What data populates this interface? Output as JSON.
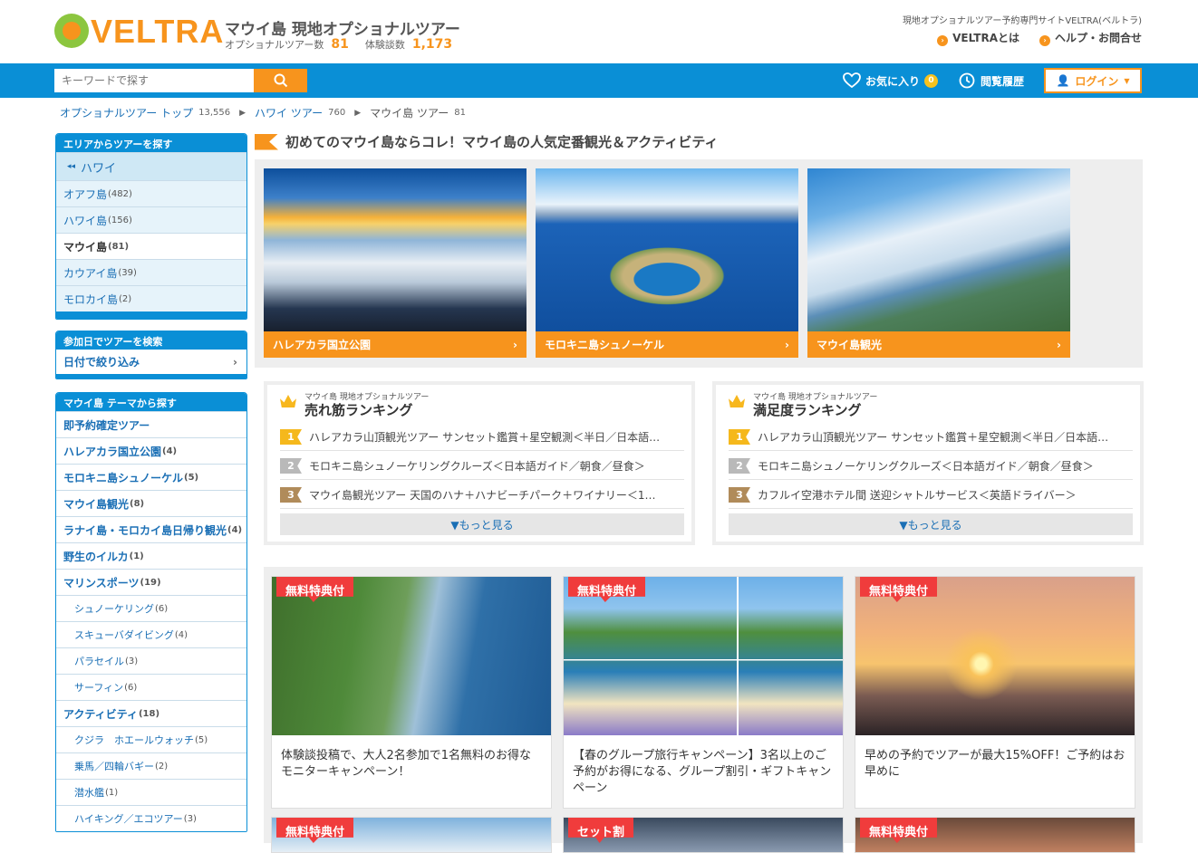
{
  "header": {
    "logo_text": "VELTRA",
    "site_title": "マウイ島 現地オプショナルツアー",
    "tour_count_label": "オプショナルツアー数",
    "tour_count": "81",
    "review_count_label": "体験談数",
    "review_count": "1,173",
    "tagline": "現地オプショナルツアー予約専門サイトVELTRA(ベルトラ)",
    "links": [
      "VELTRAとは",
      "ヘルプ・お問合せ"
    ]
  },
  "navbar": {
    "search_placeholder": "キーワードで探す",
    "favorites_label": "お気に入り",
    "favorites_count": "0",
    "history_label": "閲覧履歴",
    "login_label": "ログイン"
  },
  "breadcrumb": [
    {
      "label": "オプショナルツアー トップ",
      "count": "13,556"
    },
    {
      "label": "ハワイ ツアー",
      "count": "760"
    },
    {
      "label": "マウイ島 ツアー",
      "count": "81"
    }
  ],
  "sidebar": {
    "area_heading": "エリアからツアーを探す",
    "area_parent": "ハワイ",
    "areas": [
      {
        "label": "オアフ島",
        "count": "(482)"
      },
      {
        "label": "ハワイ島",
        "count": "(156)"
      },
      {
        "label": "マウイ島",
        "count": "(81)"
      },
      {
        "label": "カウアイ島",
        "count": "(39)"
      },
      {
        "label": "モロカイ島",
        "count": "(2)"
      }
    ],
    "date_heading": "参加日でツアーを検索",
    "date_label": "日付で絞り込み",
    "theme_heading": "マウイ島 テーマから探す",
    "themes": [
      {
        "label": "即予約確定ツアー",
        "count": ""
      },
      {
        "label": "ハレアカラ国立公園",
        "count": "(4)"
      },
      {
        "label": "モロキニ島シュノーケル",
        "count": "(5)"
      },
      {
        "label": "マウイ島観光",
        "count": "(8)"
      },
      {
        "label": "ラナイ島・モロカイ島日帰り観光",
        "count": "(4)"
      },
      {
        "label": "野生のイルカ",
        "count": "(1)"
      },
      {
        "label": "マリンスポーツ",
        "count": "(19)"
      },
      {
        "label": "シュノーケリング",
        "count": "(6)"
      },
      {
        "label": "スキューバダイビング",
        "count": "(4)"
      },
      {
        "label": "パラセイル",
        "count": "(3)"
      },
      {
        "label": "サーフィン",
        "count": "(6)"
      },
      {
        "label": "アクティビティ",
        "count": "(18)"
      },
      {
        "label": "クジラ　ホエールウォッチ",
        "count": "(5)"
      },
      {
        "label": "乗馬／四輪バギー",
        "count": "(2)"
      },
      {
        "label": "潜水艦",
        "count": "(1)"
      },
      {
        "label": "ハイキング／エコツアー",
        "count": "(3)"
      }
    ]
  },
  "main": {
    "title": "初めてのマウイ島ならコレ！マウイ島の人気定番観光＆アクティビティ",
    "features": [
      {
        "label": "ハレアカラ国立公園"
      },
      {
        "label": "モロキニ島シュノーケル"
      },
      {
        "label": "マウイ島観光"
      }
    ],
    "rankings": [
      {
        "subtitle": "マウイ島 現地オプショナルツアー",
        "title": "売れ筋ランキング",
        "items": [
          "ハレアカラ山頂観光ツアー サンセット鑑賞＋星空観測＜半日／日本語…",
          "モロキニ島シュノーケリングクルーズ＜日本語ガイド／朝食／昼食＞",
          "マウイ島観光ツアー 天国のハナ＋ハナビーチパーク＋ワイナリー＜1…"
        ],
        "more": "▼もっと見る"
      },
      {
        "subtitle": "マウイ島 現地オプショナルツアー",
        "title": "満足度ランキング",
        "items": [
          "ハレアカラ山頂観光ツアー サンセット鑑賞＋星空観測＜半日／日本語…",
          "モロキニ島シュノーケリングクルーズ＜日本語ガイド／朝食／昼食＞",
          "カフルイ空港ホテル間 送迎シャトルサービス＜英語ドライバー＞"
        ],
        "more": "▼もっと見る"
      }
    ],
    "promos": [
      {
        "ribbon": "無料特典付",
        "text": "体験談投稿で、大人2名参加で1名無料のお得なモニターキャンペーン！"
      },
      {
        "ribbon": "無料特典付",
        "text": "【春のグループ旅行キャンペーン】3名以上のご予約がお得になる、グループ割引・ギフトキャンペーン"
      },
      {
        "ribbon": "無料特典付",
        "text": "早めの予約でツアーが最大15%OFF！ご予約はお早めに"
      }
    ],
    "promos_row2": [
      {
        "ribbon": "無料特典付"
      },
      {
        "ribbon": "セット割"
      },
      {
        "ribbon": "無料特典付"
      }
    ]
  },
  "colors": {
    "brand_orange": "#f7941d",
    "brand_green": "#8cc63f",
    "nav_blue": "#0a8fd6",
    "ribbon_red": "#f03c3c"
  }
}
